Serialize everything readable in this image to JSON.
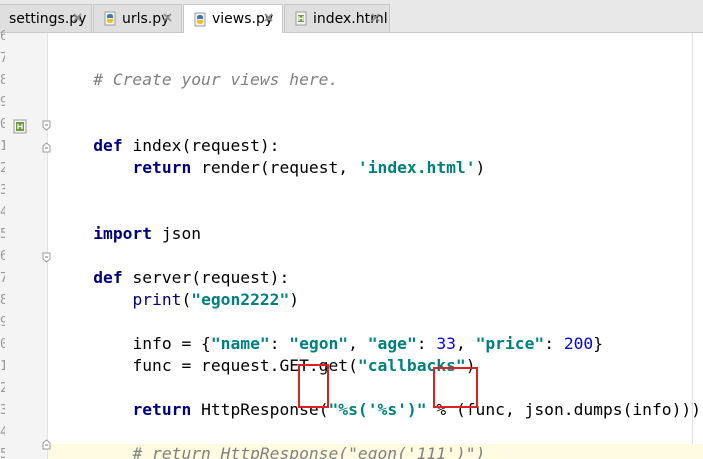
{
  "tabs": [
    {
      "label": "settings.py",
      "icon": "python-file-icon",
      "active": false
    },
    {
      "label": "urls.py",
      "icon": "python-file-icon",
      "active": false
    },
    {
      "label": "views.py",
      "icon": "python-file-icon",
      "active": true
    },
    {
      "label": "index.html",
      "icon": "html-file-icon",
      "active": false
    }
  ],
  "gutter": {
    "line_numbers": [
      "6",
      "7",
      "8",
      "9",
      "0",
      "1",
      "2",
      "3",
      "4",
      "5",
      "6",
      "7",
      "8",
      "9",
      "0",
      "1",
      "2",
      "3",
      "4",
      "5",
      "6"
    ]
  },
  "code": {
    "line_comment_create": "# Create your views here.",
    "kw_def_1": "def",
    "index_sig": " index(request):",
    "kw_return_1": "return",
    "render_call_pre": " render(request, ",
    "render_str": "'index.html'",
    "render_call_post": ")",
    "kw_import": "import",
    "import_mod": " json",
    "kw_def_2": "def",
    "server_sig": " server(request):",
    "print_fn": "print",
    "print_open": "(",
    "print_str": "\"egon2222\"",
    "print_close": ")",
    "info_pre": "info = {",
    "info_k1": "\"name\"",
    "info_c1": ": ",
    "info_v1": "\"egon\"",
    "info_sep1": ", ",
    "info_k2": "\"age\"",
    "info_c2": ": ",
    "info_v2": "33",
    "info_sep2": ", ",
    "info_k3": "\"price\"",
    "info_c3": ": ",
    "info_v3": "200",
    "info_post": "}",
    "func_pre": "func = request.GET.get(",
    "func_str": "\"callbacks\"",
    "func_post": ")",
    "kw_return_2": "return",
    "resp_pre": " HttpResponse(",
    "resp_str": "\"%s('%s')\"",
    "resp_post": " % (func, json.dumps(info)))",
    "line_comment_return": "# return HttpResponse(\"egon('111')\")"
  },
  "colors": {
    "keyword": "#000080",
    "string": "#008080",
    "number": "#0000ff",
    "comment": "#808080",
    "highlight_box": "#e02020"
  }
}
